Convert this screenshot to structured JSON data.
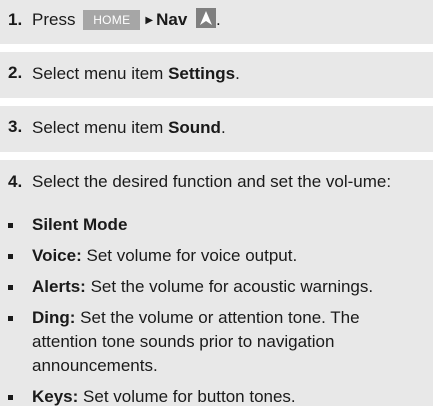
{
  "steps": [
    {
      "num": "1.",
      "pre": "Press",
      "key": "HOME",
      "nav": "Nav"
    },
    {
      "num": "2.",
      "pre": "Select menu item ",
      "bold": "Settings",
      "post": "."
    },
    {
      "num": "3.",
      "pre": "Select menu item ",
      "bold": "Sound",
      "post": "."
    },
    {
      "num": "4.",
      "text": "Select the desired function and set the vol-ume:"
    }
  ],
  "bullets": [
    {
      "bold": "Silent Mode",
      "text": ""
    },
    {
      "bold": "Voice:",
      "text": " Set volume for voice output."
    },
    {
      "bold": "Alerts:",
      "text": " Set the volume for acoustic warnings."
    },
    {
      "bold": "Ding:",
      "text": " Set the volume or attention tone. The attention tone sounds prior to navigation announcements."
    },
    {
      "bold": "Keys:",
      "text": " Set volume for button tones."
    }
  ],
  "colors": {
    "row_bg": "#e8e8e8",
    "key_bg": "#a6a6a6",
    "icon_bg": "#7f7f7f"
  },
  "icons": {
    "nav": "navigation-arrow-icon",
    "arrow": "right-triangle-icon",
    "bullet": "square-bullet-icon"
  }
}
